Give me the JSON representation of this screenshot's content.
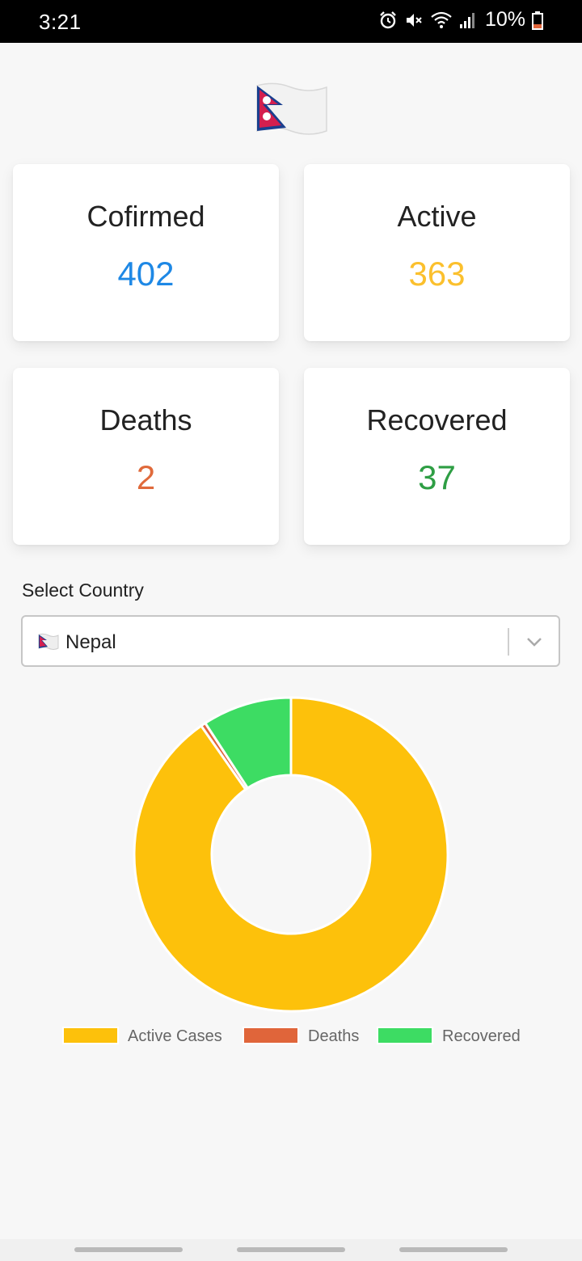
{
  "status_bar": {
    "time": "3:21",
    "battery": "10%",
    "icons": [
      "alarm-icon",
      "mute-icon",
      "wifi-icon",
      "signal-icon",
      "battery-icon"
    ]
  },
  "cards": {
    "confirmed": {
      "label": "Cofirmed",
      "value": "402",
      "color": "#1e88e5"
    },
    "active": {
      "label": "Active",
      "value": "363",
      "color": "#fbc02d"
    },
    "deaths": {
      "label": "Deaths",
      "value": "2",
      "color": "#e06a3b"
    },
    "recovered": {
      "label": "Recovered",
      "value": "37",
      "color": "#2e9e44"
    }
  },
  "country_select": {
    "label": "Select Country",
    "selected": "Nepal"
  },
  "chart_data": {
    "type": "pie",
    "variant": "doughnut",
    "categories": [
      "Active Cases",
      "Deaths",
      "Recovered"
    ],
    "values": [
      363,
      2,
      37
    ],
    "colors": [
      "#fdc10b",
      "#e0653a",
      "#3ddc63"
    ],
    "legend": "bottom"
  }
}
